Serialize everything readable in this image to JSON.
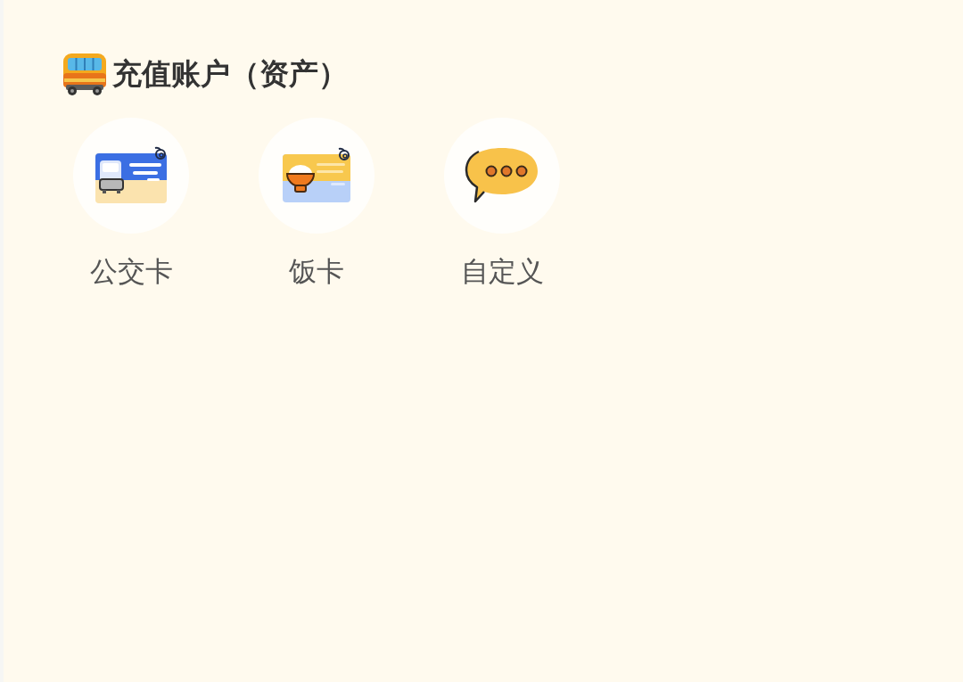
{
  "section": {
    "title": "充值账户（资产）"
  },
  "accounts": [
    {
      "kind": "bus-card",
      "label": "公交卡"
    },
    {
      "kind": "meal-card",
      "label": "饭卡"
    },
    {
      "kind": "custom",
      "label": "自定义"
    }
  ]
}
